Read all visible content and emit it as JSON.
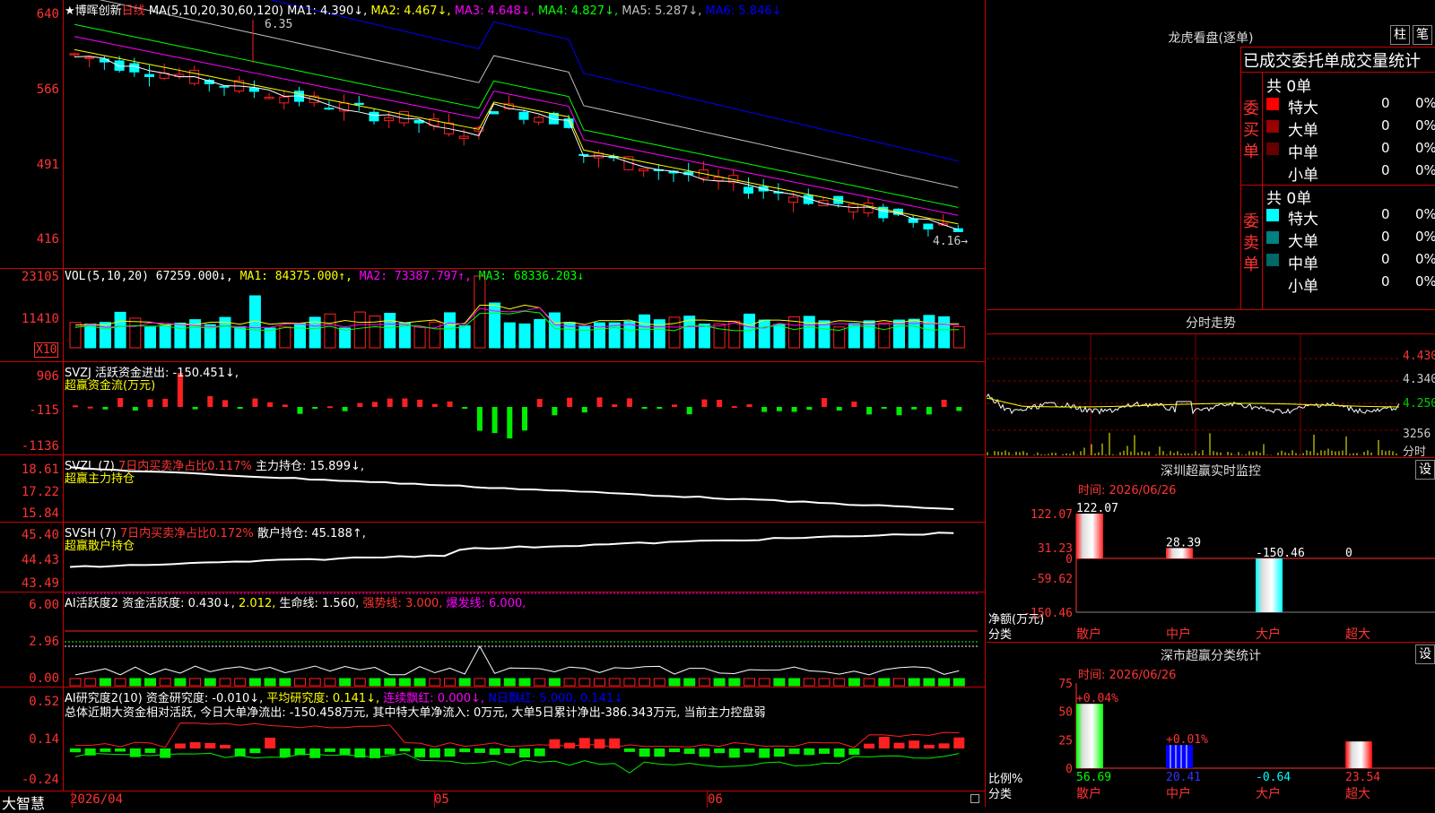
{
  "main": {
    "title_stock": "★博晖创新",
    "title_period": "日线",
    "ma_label": "MA(5,10,20,30,60,120)",
    "ma": [
      {
        "label": "MA1: 4.390↓,",
        "color": "#ffffff"
      },
      {
        "label": "MA2: 4.467↓,",
        "color": "#ffff00"
      },
      {
        "label": "MA3: 4.648↓,",
        "color": "#ff00ff"
      },
      {
        "label": "MA4: 4.827↓,",
        "color": "#00ff00"
      },
      {
        "label": "MA5: 5.287↓,",
        "color": "#c0c0c0"
      },
      {
        "label": "MA6: 5.846↓",
        "color": "#0000ff"
      }
    ],
    "y_labels": [
      "640",
      "566",
      "491",
      "416"
    ],
    "high_mark": "6.35",
    "low_mark": "4.16→"
  },
  "vol": {
    "header": [
      {
        "t": "VOL(5,10,20) 67259.000↓,",
        "c": "#ffffff"
      },
      {
        "t": "MA1: 84375.000↑,",
        "c": "#ffff00"
      },
      {
        "t": "MA2: 73387.797↑,",
        "c": "#ff00ff"
      },
      {
        "t": "MA3: 68336.203↓",
        "c": "#00ff00"
      }
    ],
    "y_labels": [
      "23105",
      "11410"
    ],
    "unit": "X10"
  },
  "svzj": {
    "header": [
      {
        "t": "SVZJ  活跃资金进出: -150.451↓,",
        "c": "#ffffff"
      }
    ],
    "sub": "超赢资金流(万元)",
    "y_labels": [
      "906",
      "-115",
      "-1136"
    ]
  },
  "svzl": {
    "header": [
      {
        "t": "SVZL (7)",
        "c": "#ffffff"
      },
      {
        "t": "7日内买卖净占比0.117%",
        "c": "#ff3333"
      },
      {
        "t": "主力持仓: 15.899↓,",
        "c": "#ffffff"
      }
    ],
    "sub": "超赢主力持仓",
    "y_labels": [
      "18.61",
      "17.22",
      "15.84"
    ]
  },
  "svsh": {
    "header": [
      {
        "t": "SVSH (7)",
        "c": "#ffffff"
      },
      {
        "t": "7日内买卖净占比0.172%",
        "c": "#ff3333"
      },
      {
        "t": "散户持仓: 45.188↑,",
        "c": "#ffffff"
      }
    ],
    "sub": "超赢散户持仓",
    "y_labels": [
      "45.40",
      "44.43",
      "43.49"
    ]
  },
  "ai1": {
    "header": [
      {
        "t": "AI活跃度2 资金活跃度: 0.430↓,",
        "c": "#ffffff"
      },
      {
        "t": "2.012,",
        "c": "#ffff00"
      },
      {
        "t": "生命线: 1.560,",
        "c": "#ffffff"
      },
      {
        "t": "强势线: 3.000,",
        "c": "#ff3333"
      },
      {
        "t": "爆发线: 6.000,",
        "c": "#ff00ff"
      }
    ],
    "y_labels": [
      "6.00",
      "2.96",
      "0.00"
    ]
  },
  "ai2": {
    "header": [
      {
        "t": "AI研究度2(10) 资金研究度: -0.010↓,",
        "c": "#ffffff"
      },
      {
        "t": "平均研究度: 0.141↓,",
        "c": "#ffff00"
      },
      {
        "t": "连续飘红: 0.000↓,",
        "c": "#ff00ff"
      },
      {
        "t": "N日飘红: 5.000,",
        "c": "#0000ff"
      },
      {
        "t": "0.141↓",
        "c": "#0000ff"
      }
    ],
    "note": "总体近期大资金相对活跃, 今日大单净流出: -150.458万元, 其中特大单净流入: 0万元, 大单5日累计净出-386.343万元, 当前主力控盘弱",
    "y_labels": [
      "0.52",
      "0.14",
      "-0.24"
    ]
  },
  "bottom": {
    "brand": "大智慧",
    "date_labels": [
      "2026/04",
      "05",
      "06"
    ]
  },
  "lhb": {
    "title": "龙虎看盘(逐单)",
    "btn_bar": "柱",
    "btn_pen": "笔",
    "subtitle": "已成交委托单成交量统计",
    "buy_label": "委买单",
    "sell_label": "委卖单",
    "buy_total": "共 0单",
    "sell_total": "共 0单",
    "buy_rows": [
      {
        "name": "特大",
        "val": "0",
        "pct": "0%",
        "color": "#ff0000"
      },
      {
        "name": "大单",
        "val": "0",
        "pct": "0%",
        "color": "#990000"
      },
      {
        "name": "中单",
        "val": "0",
        "pct": "0%",
        "color": "#660000"
      },
      {
        "name": "小单",
        "val": "0",
        "pct": "0%",
        "color": ""
      }
    ],
    "sell_rows": [
      {
        "name": "特大",
        "val": "0",
        "pct": "0%",
        "color": "#00ffff"
      },
      {
        "name": "大单",
        "val": "0",
        "pct": "0%",
        "color": "#008080"
      },
      {
        "name": "中单",
        "val": "0",
        "pct": "0%",
        "color": "#006666"
      },
      {
        "name": "小单",
        "val": "0",
        "pct": "0%",
        "color": ""
      }
    ]
  },
  "fenshi": {
    "title": "分时走势",
    "y_labels": [
      "4.430",
      "4.340",
      "4.250"
    ],
    "vol_label": "3256",
    "unit": "分时"
  },
  "monitor": {
    "title": "深圳超赢实时监控",
    "set": "设",
    "time": "时间: 2026/06/26",
    "y_labels": [
      "122.07",
      "31.23",
      "0",
      "-59.62",
      "-150.46"
    ],
    "ylabel1": "净额(万元)",
    "ylabel2": "分类",
    "bars": [
      {
        "cat": "散户",
        "value": 122.07,
        "label": "122.07"
      },
      {
        "cat": "中户",
        "value": 28.39,
        "label": "28.39"
      },
      {
        "cat": "大户",
        "value": -150.46,
        "label": "-150.46"
      },
      {
        "cat": "超大",
        "value": 0,
        "label": "0"
      }
    ]
  },
  "classify": {
    "title": "深市超赢分类统计",
    "set": "设",
    "time": "时间: 2026/06/26",
    "y_labels": [
      "75",
      "50",
      "25",
      "0"
    ],
    "ylabel1": "比例%",
    "ylabel2": "分类",
    "bars": [
      {
        "cat": "散户",
        "value": 56.69,
        "label": "56.69",
        "top": "+0.04%",
        "color": "#00ff00"
      },
      {
        "cat": "中户",
        "value": 20.41,
        "label": "20.41",
        "top": "+0.01%",
        "color": "#0000ff"
      },
      {
        "cat": "大户",
        "value": -0.64,
        "label": "-0.64",
        "top": "",
        "color": "#00ffff"
      },
      {
        "cat": "超大",
        "value": 23.54,
        "label": "23.54",
        "top": "",
        "color": "#ff0000"
      }
    ]
  }
}
